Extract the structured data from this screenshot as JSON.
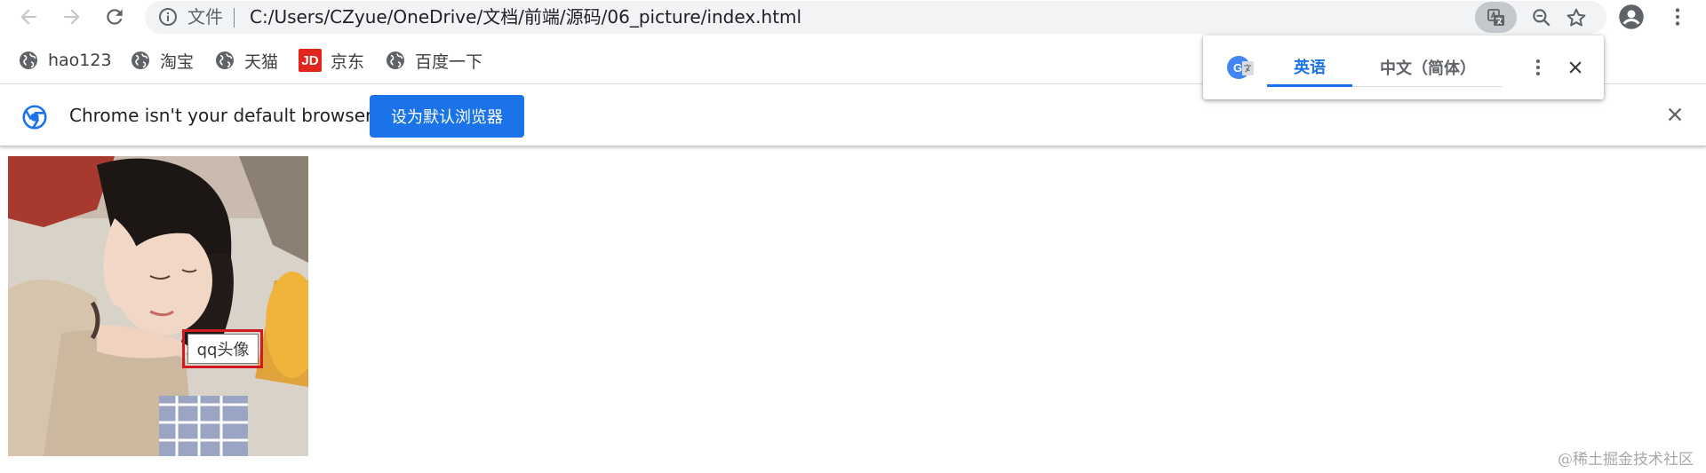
{
  "toolbar": {
    "address_prefix": "文件",
    "url": "C:/Users/CZyue/OneDrive/文档/前端/源码/06_picture/index.html"
  },
  "bookmarks": [
    {
      "label": "hao123",
      "icon": "globe-icon"
    },
    {
      "label": "淘宝",
      "icon": "globe-icon"
    },
    {
      "label": "天猫",
      "icon": "globe-icon"
    },
    {
      "label": "京东",
      "icon": "jd-logo-icon",
      "icon_text": "JD"
    },
    {
      "label": "百度一下",
      "icon": "globe-icon"
    }
  ],
  "infobar": {
    "message": "Chrome isn't your default browser",
    "button_label": "设为默认浏览器"
  },
  "translate_popup": {
    "tabs": [
      "英语",
      "中文（简体）"
    ],
    "active_tab": "英语"
  },
  "page": {
    "tooltip": "qq头像"
  },
  "watermark": "@稀土掘金技术社区",
  "colors": {
    "accent": "#1a73e8",
    "highlight_border": "#d11a24",
    "jd_brand": "#e1251b"
  }
}
